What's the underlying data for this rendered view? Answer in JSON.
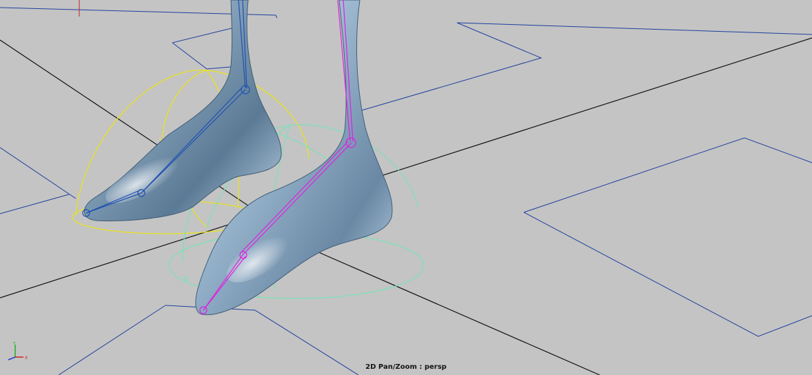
{
  "viewport": {
    "camera": "persp",
    "hud_label": "2D Pan/Zoom : persp",
    "background_color": "#c4c4c4"
  },
  "axis_gizmo": {
    "x_label": "X",
    "y_label": "Y",
    "x_color": "#d02020",
    "y_color": "#20b020",
    "z_color": "#2040d0"
  },
  "scene": {
    "grid_line_color": "#111111",
    "outline_color": "#1a3fa0",
    "left_foot": {
      "skin_color": "#8fa9bf",
      "joint_color": "#1f4fb0",
      "control_color": "#e8e21e"
    },
    "right_foot": {
      "skin_color": "#9fbbd2",
      "joint_color": "#e020e0",
      "control_color": "#7fe0b8"
    }
  }
}
